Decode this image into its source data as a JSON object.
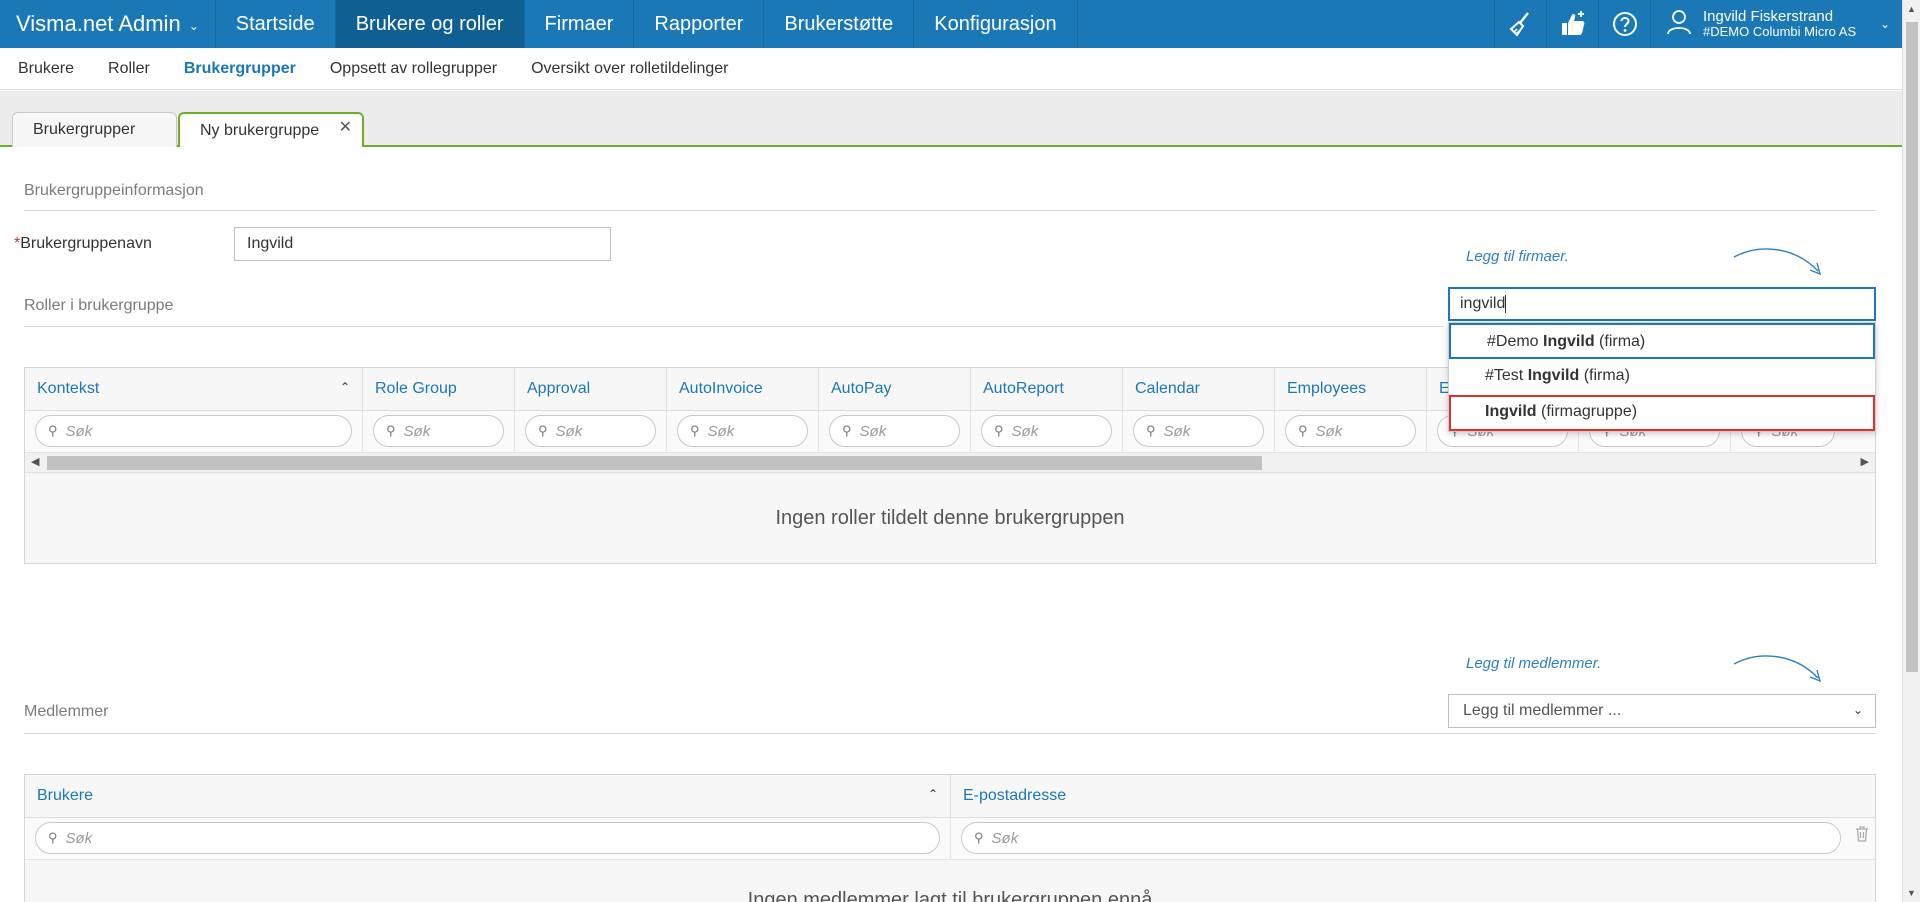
{
  "topbar": {
    "brand": "Visma.net Admin",
    "nav": [
      "Startside",
      "Brukere og roller",
      "Firmaer",
      "Rapporter",
      "Brukerstøtte",
      "Konfigurasjon"
    ],
    "user_name": "Ingvild Fiskerstrand",
    "user_company": "#DEMO Columbi Micro AS"
  },
  "subnav": [
    "Brukere",
    "Roller",
    "Brukergrupper",
    "Oppsett av rollegrupper",
    "Oversikt over rolletildelinger"
  ],
  "tabs": [
    "Brukergrupper",
    "Ny brukergruppe"
  ],
  "form": {
    "section_info": "Brukergruppeinformasjon",
    "name_required_mark": "*",
    "name_label": "Brukergruppenavn",
    "name_value": "Ingvild",
    "roles_title": "Roller i brukergruppe",
    "add_firms_hint": "Legg til firmaer.",
    "firm_search_value": "ingvild",
    "dropdown": [
      {
        "pre": "#Demo ",
        "bold": "Ingvild",
        "post": " (firma)"
      },
      {
        "pre": "#Test ",
        "bold": "Ingvild",
        "post": " (firma)"
      },
      {
        "pre": "",
        "bold": "Ingvild",
        "post": " (firmagruppe)"
      }
    ]
  },
  "roles_grid": {
    "columns": [
      "Kontekst",
      "Role Group",
      "Approval",
      "AutoInvoice",
      "AutoPay",
      "AutoReport",
      "Calendar",
      "Employees",
      "E",
      "",
      ""
    ],
    "search_placeholder": "Søk",
    "empty_text": "Ingen roller tildelt denne brukergruppen"
  },
  "members": {
    "hint": "Legg til medlemmer.",
    "title": "Medlemmer",
    "select_placeholder": "Legg til medlemmer ...",
    "columns": [
      "Brukere",
      "E-postadresse"
    ],
    "search_placeholder": "Søk",
    "empty_text": "Ingen medlemmer lagt til brukergruppen ennå"
  },
  "colors": {
    "primary": "#1a78b7",
    "active_nav": "#0f5f93",
    "tab_green": "#6fac2c",
    "highlight_red": "#e03030"
  }
}
